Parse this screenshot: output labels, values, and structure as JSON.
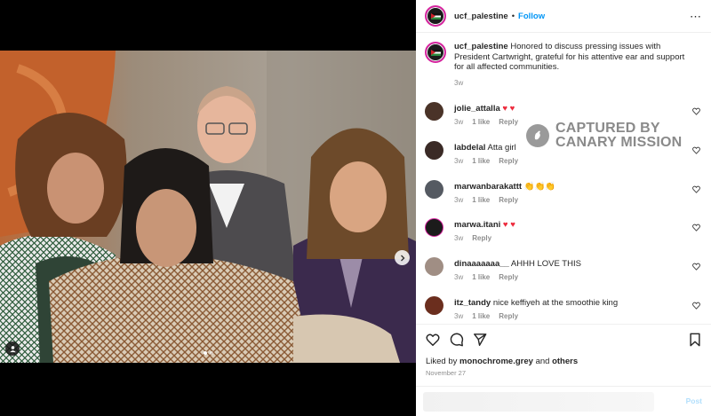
{
  "post": {
    "username": "ucf_palestine",
    "separator": "•",
    "follow_label": "Follow",
    "more_icon": "⋯",
    "caption_username": "ucf_palestine",
    "caption_text": "Honored to discuss pressing issues with President Cartwright, grateful for his attentive ear and support for all affected communities.",
    "caption_time": "3w"
  },
  "watermark": {
    "line1": "CAPTURED BY",
    "line2": "CANARY MISSION"
  },
  "comments": [
    {
      "username": "jolie_attalla",
      "text": "",
      "emoji": "♥ ♥",
      "time": "3w",
      "likes": "1 like",
      "reply": "Reply",
      "avatar_color": "#4a3328"
    },
    {
      "username": "labdelal",
      "text": "Atta girl",
      "emoji": "",
      "time": "3w",
      "likes": "1 like",
      "reply": "Reply",
      "avatar_color": "#3a2a26"
    },
    {
      "username": "marwanbarakattt",
      "text": "",
      "emoji": "👏👏👏",
      "time": "3w",
      "likes": "1 like",
      "reply": "Reply",
      "avatar_color": "#555a62"
    },
    {
      "username": "marwa.itani",
      "text": "",
      "emoji": "♥ ♥",
      "time": "3w",
      "likes": "",
      "reply": "Reply",
      "avatar_color": "#1b1b1b"
    },
    {
      "username": "dinaaaaaaa__",
      "text": "AHHH LOVE THIS",
      "emoji": "",
      "time": "3w",
      "likes": "1 like",
      "reply": "Reply",
      "avatar_color": "#a08e84"
    },
    {
      "username": "itz_tandy",
      "text": "nice keffiyeh at the smoothie king",
      "emoji": "",
      "time": "3w",
      "likes": "1 like",
      "reply": "Reply",
      "avatar_color": "#6b2e1e"
    }
  ],
  "footer": {
    "liked_by_prefix": "Liked by",
    "liked_by_user": "monochrome.grey",
    "liked_by_and": "and",
    "liked_by_others": "others",
    "date": "November 27",
    "post_label": "Post"
  },
  "colors": {
    "accent": "#0095f6",
    "heart_red": "#ed2a3c",
    "clap_yellow": "#f5c518"
  }
}
